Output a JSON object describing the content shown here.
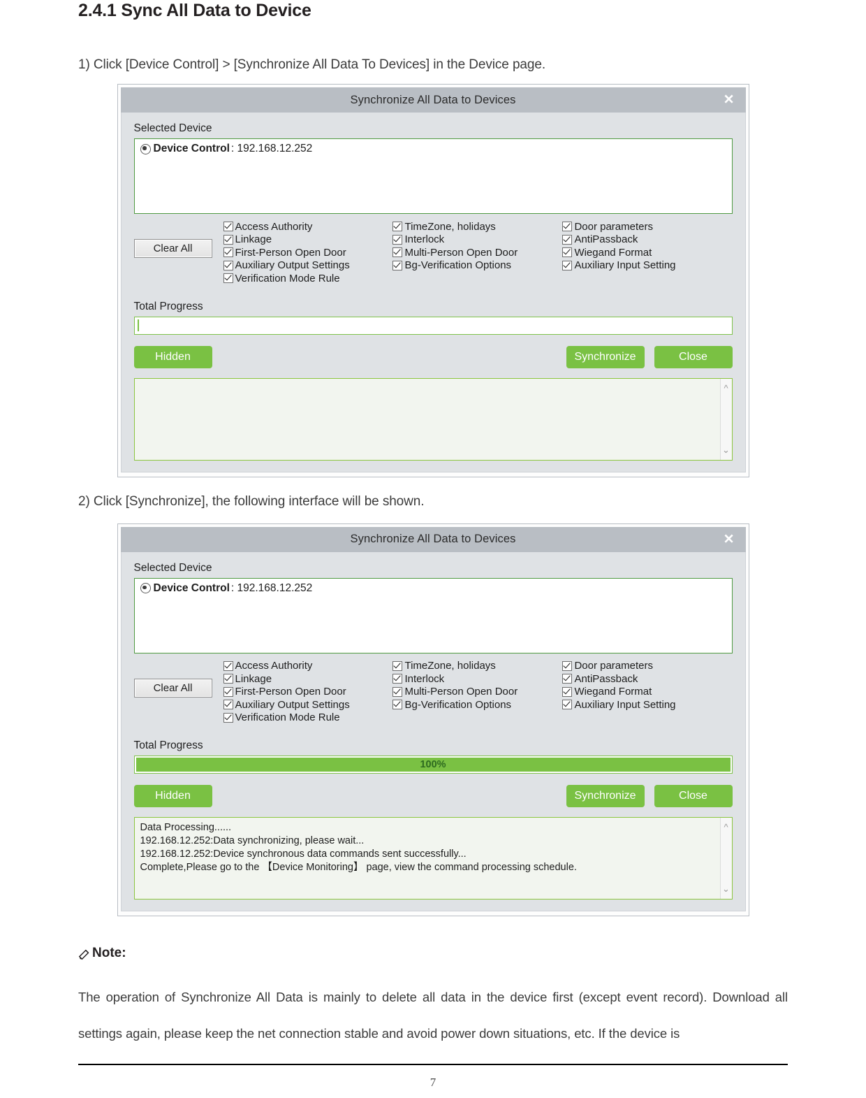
{
  "document": {
    "heading": "2.4.1 Sync All Data to Device",
    "step1": "1) Click [Device Control] > [Synchronize All Data To Devices] in the Device page.",
    "step2": "2) Click [Synchronize], the following interface will be shown.",
    "note_label": "Note:",
    "note_icon": "pencil-icon",
    "note_body": "The operation of Synchronize All Data is mainly to delete all data in the device first (except event record). Download all settings again, please keep the net connection stable and avoid power down situations, etc. If the device is",
    "page_number": "7"
  },
  "colors": {
    "accent_green": "#7ac143",
    "titlebar_gray": "#b9bec4",
    "dialog_body": "#dfe2e5",
    "box_border_green": "#4f9a41",
    "log_bg": "#f2f5ef",
    "progress_text": "#2d6a1f"
  },
  "dialog_common": {
    "title": "Synchronize All Data to Devices",
    "close_icon": "close-icon",
    "selected_device_label": "Selected Device",
    "device": {
      "name": "Device Control",
      "ip": ": 192.168.12.252",
      "selected": true
    },
    "clear_all_label": "Clear All",
    "option_columns": [
      [
        {
          "label": "Access Authority",
          "checked": true
        },
        {
          "label": "Linkage",
          "checked": true
        },
        {
          "label": "First-Person Open Door",
          "checked": true
        },
        {
          "label": "Auxiliary Output Settings",
          "checked": true
        },
        {
          "label": "Verification Mode Rule",
          "checked": true
        }
      ],
      [
        {
          "label": "TimeZone, holidays",
          "checked": true
        },
        {
          "label": "Interlock",
          "checked": true
        },
        {
          "label": "Multi-Person Open Door",
          "checked": true
        },
        {
          "label": "Bg-Verification Options",
          "checked": true
        }
      ],
      [
        {
          "label": "Door parameters",
          "checked": true
        },
        {
          "label": "AntiPassback",
          "checked": true
        },
        {
          "label": "Wiegand Format",
          "checked": true
        },
        {
          "label": "Auxiliary Input Setting",
          "checked": true
        }
      ]
    ],
    "total_progress_label": "Total Progress",
    "buttons": {
      "hidden": "Hidden",
      "synchronize": "Synchronize",
      "close": "Close"
    },
    "scroll_up_icon": "chevron-up-icon",
    "scroll_down_icon": "chevron-down-icon"
  },
  "dialog_before": {
    "progress_percent": 0,
    "progress_text": "",
    "log_lines": []
  },
  "dialog_after": {
    "progress_percent": 100,
    "progress_text": "100%",
    "log_lines": [
      "Data Processing......",
      "192.168.12.252:Data synchronizing, please wait...",
      "192.168.12.252:Device synchronous data commands sent successfully...",
      "Complete,Please go to the 【Device Monitoring】 page, view the command processing schedule."
    ]
  }
}
